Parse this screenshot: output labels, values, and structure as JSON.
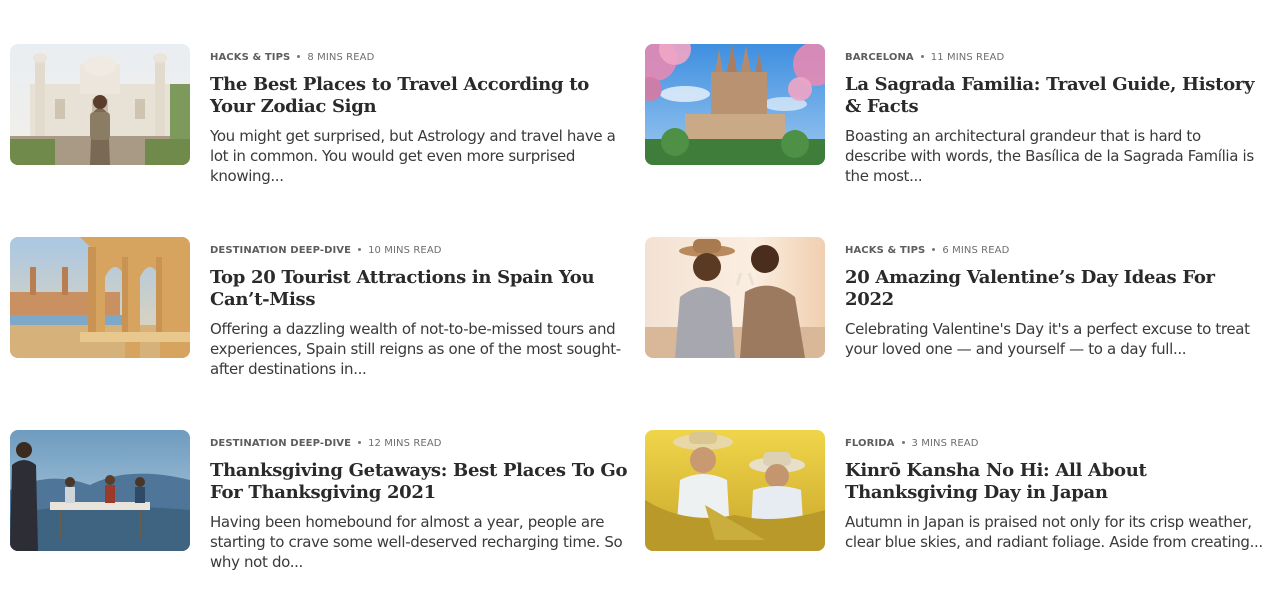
{
  "articles": [
    {
      "category": "HACKS & TIPS",
      "read_time": "8 MINS READ",
      "title": "The Best Places to Travel According to Your Zodiac Sign",
      "excerpt": "You might get surprised, but Astrology and travel have a lot in common. You would get even more surprised knowing...",
      "image": "woman-at-palace-photo"
    },
    {
      "category": "BARCELONA",
      "read_time": "11 MINS READ",
      "title": "La Sagrada Familia: Travel Guide, History & Facts",
      "excerpt": "Boasting an architectural grandeur that is hard to describe with words, the Basílica de la Sagrada Família is the most...",
      "image": "sagrada-familia-photo"
    },
    {
      "category": "DESTINATION DEEP-DIVE",
      "read_time": "10 MINS READ",
      "title": "Top 20 Tourist Attractions in Spain You Can’t-Miss",
      "excerpt": "Offering a dazzling wealth of not-to-be-missed tours and experiences, Spain still reigns as one of the most sought-after destinations in...",
      "image": "plaza-de-espana-photo"
    },
    {
      "category": "HACKS & TIPS",
      "read_time": "6 MINS READ",
      "title": "20 Amazing Valentine’s Day Ideas For 2022",
      "excerpt": "Celebrating Valentine's Day it's a perfect excuse to treat your loved one — and yourself — to a day full...",
      "image": "couple-toasting-photo"
    },
    {
      "category": "DESTINATION DEEP-DIVE",
      "read_time": "12 MINS READ",
      "title": "Thanksgiving Getaways: Best Places To Go For Thanksgiving 2021",
      "excerpt": "Having been homebound for almost a year, people are starting to crave some well-deserved recharging time. So why not do...",
      "image": "outdoor-dinner-photo"
    },
    {
      "category": "FLORIDA",
      "read_time": "3 MINS READ",
      "title": "Kinrō Kansha No Hi: All About Thanksgiving Day in Japan",
      "excerpt": "Autumn in Japan is praised not only for its crisp weather, clear blue skies, and radiant foliage. Aside from creating...",
      "image": "rice-harvest-photo"
    }
  ],
  "colors": {
    "title": "#2a2a2a",
    "meta": "#6e6e6e",
    "excerpt": "#3a3a3a"
  }
}
